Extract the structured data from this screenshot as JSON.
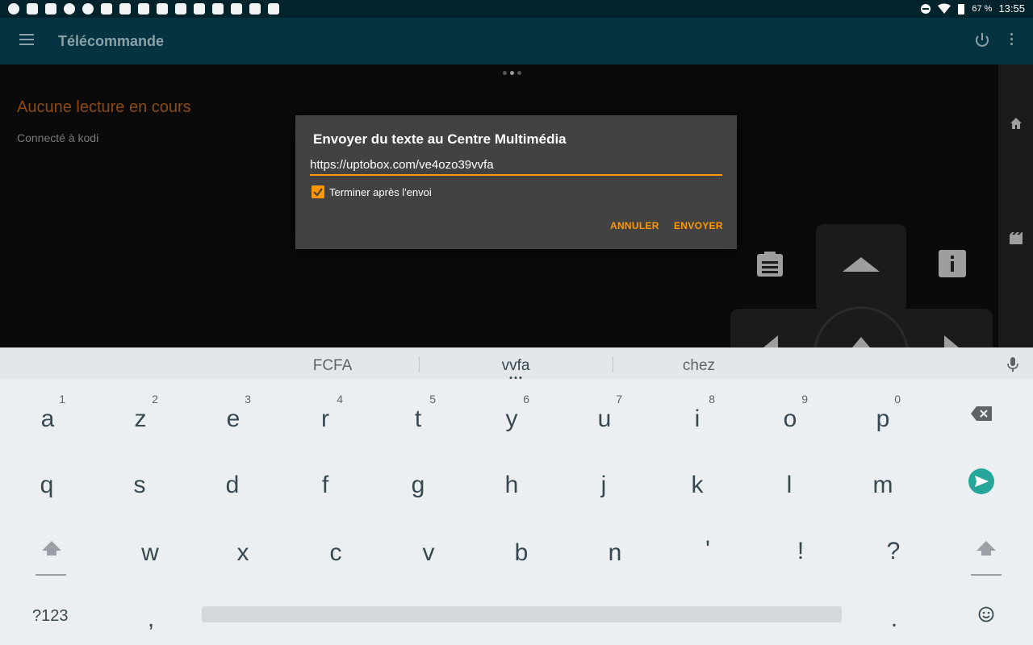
{
  "status_bar": {
    "battery": "67 %",
    "time": "13:55",
    "icons": [
      "chrome-icon",
      "notification-icon",
      "tv-icon",
      "cloud-icon",
      "target-icon",
      "usb-icon",
      "keyboard-icon",
      "image-icon",
      "check-icon",
      "youtube-icon",
      "youtube-icon",
      "youtube-icon",
      "instagram-icon",
      "square-icon",
      "play-store-icon"
    ]
  },
  "toolbar": {
    "title": "Télécommande",
    "menu_icon": "hamburger-icon",
    "power_icon": "power-icon",
    "overflow_icon": "more-vert-icon"
  },
  "main": {
    "now_playing": "Aucune lecture en cours",
    "connection": "Connecté à kodi"
  },
  "dialog": {
    "title": "Envoyer du texte au Centre Multimédia",
    "input_value": "https://uptobox.com/ve4ozo39vvfa",
    "checkbox_label": "Terminer après l'envoi",
    "checkbox_checked": true,
    "cancel": "ANNULER",
    "send": "ENVOYER"
  },
  "keyboard": {
    "suggestions": [
      "FCFA",
      "vvfa",
      "chez"
    ],
    "row1": [
      {
        "ch": "a",
        "num": "1"
      },
      {
        "ch": "z",
        "num": "2"
      },
      {
        "ch": "e",
        "num": "3"
      },
      {
        "ch": "r",
        "num": "4"
      },
      {
        "ch": "t",
        "num": "5"
      },
      {
        "ch": "y",
        "num": "6"
      },
      {
        "ch": "u",
        "num": "7"
      },
      {
        "ch": "i",
        "num": "8"
      },
      {
        "ch": "o",
        "num": "9"
      },
      {
        "ch": "p",
        "num": "0"
      }
    ],
    "row2": [
      "q",
      "s",
      "d",
      "f",
      "g",
      "h",
      "j",
      "k",
      "l",
      "m"
    ],
    "row3": [
      "w",
      "x",
      "c",
      "v",
      "b",
      "n",
      "'",
      "!",
      "?"
    ],
    "row4": {
      "symbols": "?123",
      "comma": ",",
      "period": "."
    }
  },
  "colors": {
    "accent": "#ff9800",
    "toolbar": "#053341",
    "status_bar": "#02232b",
    "dialog": "#424242",
    "send_key": "#26a69a"
  }
}
